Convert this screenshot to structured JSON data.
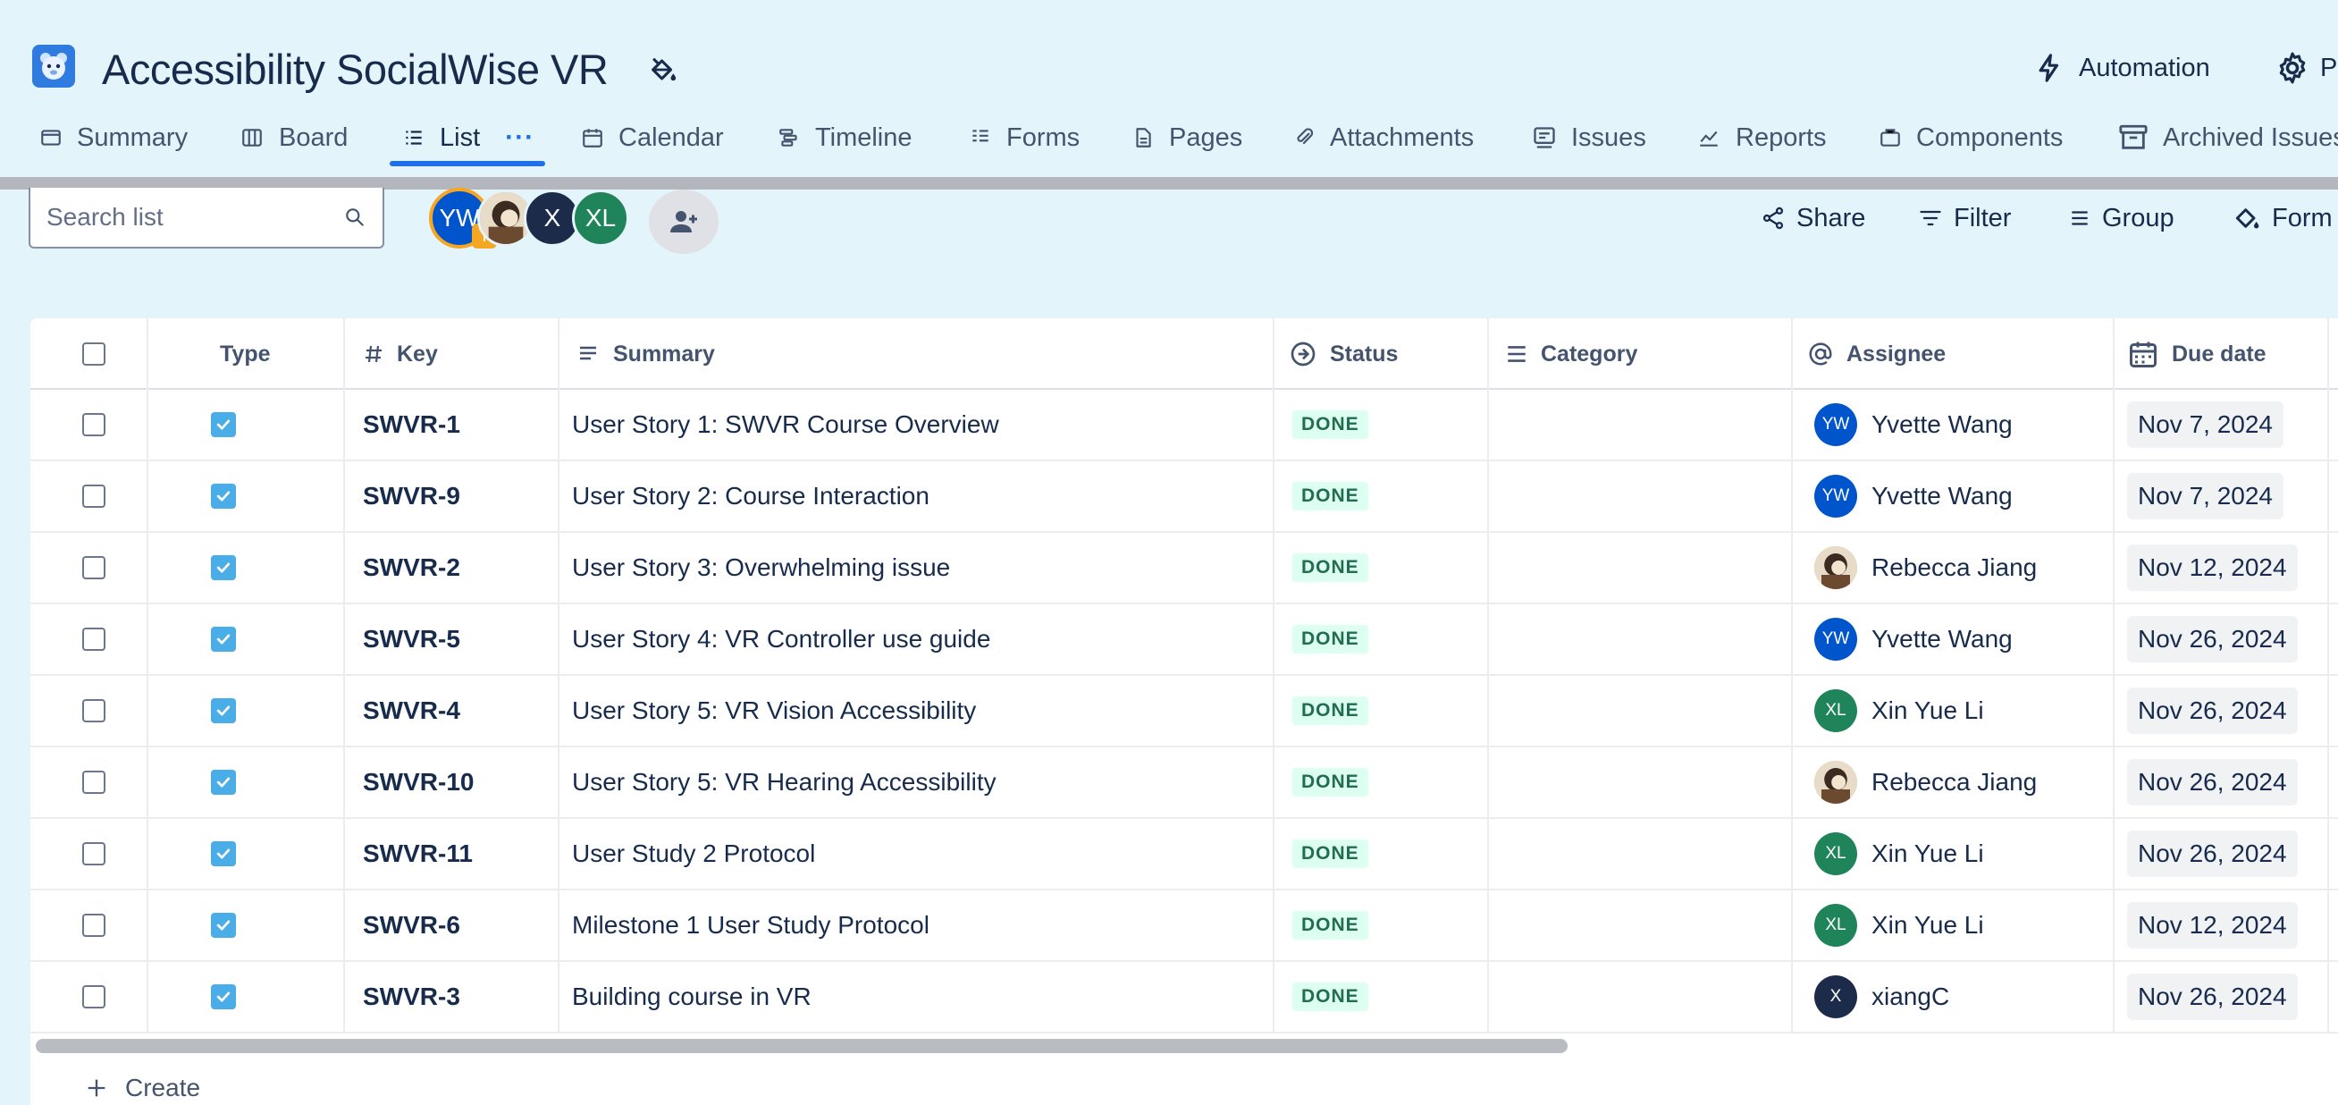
{
  "project": {
    "title": "Accessibility SocialWise VR"
  },
  "header": {
    "automation_label": "Automation",
    "settings_label": "P"
  },
  "tabs": [
    {
      "label": "Summary",
      "icon": "summary-icon"
    },
    {
      "label": "Board",
      "icon": "board-icon"
    },
    {
      "label": "List",
      "icon": "list-icon",
      "active": true
    },
    {
      "label": "Calendar",
      "icon": "calendar-icon"
    },
    {
      "label": "Timeline",
      "icon": "timeline-icon"
    },
    {
      "label": "Forms",
      "icon": "forms-icon"
    },
    {
      "label": "Pages",
      "icon": "pages-icon"
    },
    {
      "label": "Attachments",
      "icon": "paperclip-icon"
    },
    {
      "label": "Issues",
      "icon": "issues-icon"
    },
    {
      "label": "Reports",
      "icon": "reports-icon"
    },
    {
      "label": "Components",
      "icon": "components-icon"
    },
    {
      "label": "Archived Issues",
      "icon": "archive-icon"
    }
  ],
  "toolbar": {
    "search_placeholder": "Search list",
    "share_label": "Share",
    "filter_label": "Filter",
    "group_label": "Group",
    "format_label": "Form"
  },
  "avatars": [
    {
      "initials": "YW",
      "badge": "Y",
      "color": "#0055cc"
    },
    {
      "initials": "",
      "color": "#c8a37a"
    },
    {
      "initials": "X",
      "color": "#1d2b4a"
    },
    {
      "initials": "XL",
      "color": "#1f845a"
    }
  ],
  "columns": {
    "type": "Type",
    "key": "Key",
    "summary": "Summary",
    "status": "Status",
    "category": "Category",
    "assignee": "Assignee",
    "due_date": "Due date"
  },
  "rows": [
    {
      "key": "SWVR-1",
      "summary": "User Story 1: SWVR Course Overview",
      "status": "DONE",
      "assignee": "Yvette Wang",
      "assignee_initials": "YW",
      "assignee_color": "#0055cc",
      "due": "Nov 7, 2024"
    },
    {
      "key": "SWVR-9",
      "summary": "User Story 2: Course Interaction",
      "status": "DONE",
      "assignee": "Yvette Wang",
      "assignee_initials": "YW",
      "assignee_color": "#0055cc",
      "due": "Nov 7, 2024"
    },
    {
      "key": "SWVR-2",
      "summary": "User Story 3: Overwhelming issue",
      "status": "DONE",
      "assignee": "Rebecca Jiang",
      "assignee_initials": "",
      "assignee_color": "#c8a37a",
      "due": "Nov 12, 2024"
    },
    {
      "key": "SWVR-5",
      "summary": "User Story 4: VR Controller use guide",
      "status": "DONE",
      "assignee": "Yvette Wang",
      "assignee_initials": "YW",
      "assignee_color": "#0055cc",
      "due": "Nov 26, 2024"
    },
    {
      "key": "SWVR-4",
      "summary": "User Story 5: VR Vision Accessibility",
      "status": "DONE",
      "assignee": "Xin Yue Li",
      "assignee_initials": "XL",
      "assignee_color": "#1f845a",
      "due": "Nov 26, 2024"
    },
    {
      "key": "SWVR-10",
      "summary": "User Story 5: VR Hearing Accessibility",
      "status": "DONE",
      "assignee": "Rebecca Jiang",
      "assignee_initials": "",
      "assignee_color": "#c8a37a",
      "due": "Nov 26, 2024"
    },
    {
      "key": "SWVR-11",
      "summary": "User Study 2 Protocol",
      "status": "DONE",
      "assignee": "Xin Yue Li",
      "assignee_initials": "XL",
      "assignee_color": "#1f845a",
      "due": "Nov 26, 2024"
    },
    {
      "key": "SWVR-6",
      "summary": "Milestone 1 User Study Protocol",
      "status": "DONE",
      "assignee": "Xin Yue Li",
      "assignee_initials": "XL",
      "assignee_color": "#1f845a",
      "due": "Nov 12, 2024"
    },
    {
      "key": "SWVR-3",
      "summary": "Building course in VR",
      "status": "DONE",
      "assignee": "xiangC",
      "assignee_initials": "X",
      "assignee_color": "#1d2b4a",
      "due": "Nov 26, 2024"
    }
  ],
  "footer": {
    "create_label": "Create"
  },
  "colors": {
    "accent": "#1f6feb",
    "done_bg": "#dcfff1",
    "done_text": "#216e4e",
    "background": "#e4f4fb"
  }
}
